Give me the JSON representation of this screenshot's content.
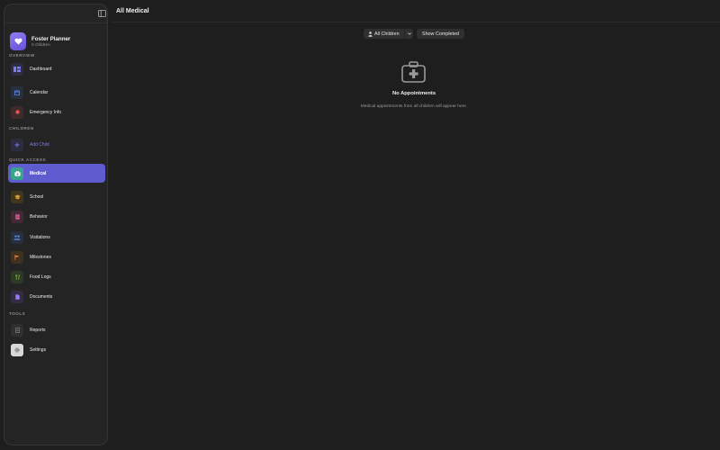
{
  "page": {
    "title": "All Medical"
  },
  "sidebar": {
    "app_title": "Foster Planner",
    "app_subtitle": "0 children",
    "sections": {
      "overview": "OVERVIEW",
      "children": "CHILDREN",
      "quick_access": "QUICK ACCESS",
      "tools": "TOOLS"
    },
    "items": [
      {
        "id": "dashboard",
        "label": "Dashboard",
        "icon": "dashboard-icon",
        "color": "#7c7cf6",
        "bg": "#2d2d44"
      },
      {
        "id": "calendar",
        "label": "Calendar",
        "icon": "calendar-icon",
        "color": "#5a8dee",
        "bg": "#283040"
      },
      {
        "id": "emergency-info",
        "label": "Emergency Info",
        "icon": "emergency-icon",
        "color": "#e05555",
        "bg": "#402a2a"
      },
      {
        "id": "add-child",
        "label": "Add Child",
        "icon": "plus-icon",
        "color": "#7c7cf6",
        "bg": "#2d2d40"
      },
      {
        "id": "medical",
        "label": "Medical",
        "icon": "medical-icon",
        "color": "#ffffff",
        "bg": "#3aa48a",
        "active": true
      },
      {
        "id": "school",
        "label": "School",
        "icon": "graduation-cap-icon",
        "color": "#e0a030",
        "bg": "#40361e"
      },
      {
        "id": "behavior",
        "label": "Behavior",
        "icon": "behavior-icon",
        "color": "#e05a9a",
        "bg": "#402a35"
      },
      {
        "id": "visitations",
        "label": "Visitations",
        "icon": "people-icon",
        "color": "#5a8dee",
        "bg": "#283040"
      },
      {
        "id": "milestones",
        "label": "Milestones",
        "icon": "flag-icon",
        "color": "#e08040",
        "bg": "#40301e"
      },
      {
        "id": "food-logs",
        "label": "Food Logs",
        "icon": "fork-knife-icon",
        "color": "#7cc050",
        "bg": "#2e3a24"
      },
      {
        "id": "documents",
        "label": "Documents",
        "icon": "document-icon",
        "color": "#9a7cf0",
        "bg": "#342c44"
      },
      {
        "id": "reports",
        "label": "Reports",
        "icon": "report-icon",
        "color": "#8c8c8c",
        "bg": "#303030"
      },
      {
        "id": "settings",
        "label": "Settings",
        "icon": "gear-icon",
        "color": "#555555",
        "bg": "#d8d8d8"
      }
    ]
  },
  "toolbar": {
    "filter_value": "All Children",
    "show_completed_label": "Show Completed"
  },
  "empty_state": {
    "title": "No Appointments",
    "description": "Medical appointments from all children will appear here."
  },
  "colors": {
    "accent": "#5e5ccf",
    "background": "#1e1e1e",
    "sidebar_bg": "#242424",
    "logo": "#7a68e8"
  }
}
